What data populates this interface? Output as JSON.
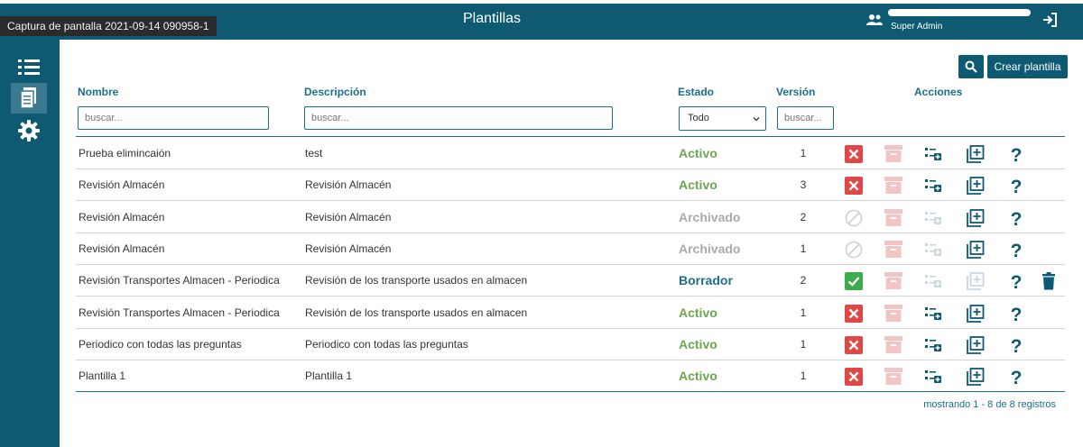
{
  "tooltip": "Captura de pantalla 2021-09-14 090958-1",
  "header": {
    "title": "Plantillas",
    "user_role": "Super Admin"
  },
  "sidebar": {
    "items": [
      {
        "icon": "list-icon"
      },
      {
        "icon": "document-icon"
      },
      {
        "icon": "gear-icon"
      }
    ]
  },
  "toolbar": {
    "create_label": "Crear plantilla"
  },
  "table": {
    "columns": {
      "name": "Nombre",
      "description": "Descripción",
      "state": "Estado",
      "version": "Versión",
      "actions": "Acciones"
    },
    "filters": {
      "name_placeholder": "buscar...",
      "description_placeholder": "buscar...",
      "state_selected": "Todo",
      "version_placeholder": "buscar..."
    },
    "rows": [
      {
        "name": "Prueba elimincaión",
        "description": "test",
        "state": "Activo",
        "version": "1"
      },
      {
        "name": "Revisión Almacén",
        "description": "Revisión Almacén",
        "state": "Activo",
        "version": "3"
      },
      {
        "name": "Revisión Almacén",
        "description": "Revisión Almacén",
        "state": "Archivado",
        "version": "2"
      },
      {
        "name": "Revisión Almacén",
        "description": "Revisión Almacén",
        "state": "Archivado",
        "version": "1"
      },
      {
        "name": "Revisión Transportes Almacen - Periodica",
        "description": "Revisión de los transporte usados en almacen",
        "state": "Borrador",
        "version": "2"
      },
      {
        "name": "Revisión Transportes Almacen - Periodica",
        "description": "Revisión de los transporte usados en almacen",
        "state": "Activo",
        "version": "1"
      },
      {
        "name": "Periodico con todas las preguntas",
        "description": "Periodico con todas las preguntas",
        "state": "Activo",
        "version": "1"
      },
      {
        "name": "Plantilla 1",
        "description": "Plantilla 1",
        "state": "Activo",
        "version": "1"
      }
    ]
  },
  "footer": {
    "paging_text": "mostrando 1 - 8 de 8 registros"
  },
  "colors": {
    "brand": "#0e5a72",
    "active": "#6aa84f",
    "archived": "#aaaaaa",
    "draft": "#1b6f8a",
    "danger": "#e04848",
    "ok": "#3cab4e"
  }
}
